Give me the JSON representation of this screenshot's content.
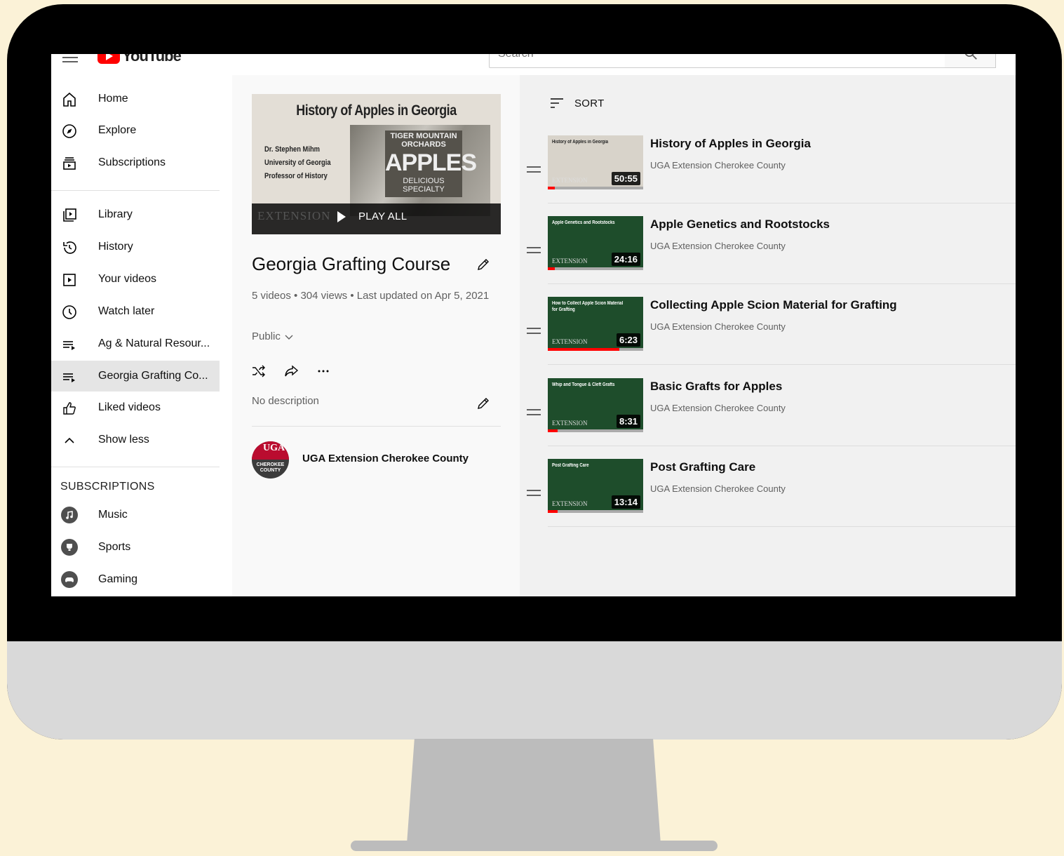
{
  "brand": {
    "name": "YouTube"
  },
  "search": {
    "placeholder": "Search"
  },
  "sidebar": {
    "items": [
      {
        "label": "Home",
        "icon": "home-icon"
      },
      {
        "label": "Explore",
        "icon": "compass-icon"
      },
      {
        "label": "Subscriptions",
        "icon": "subscriptions-icon"
      },
      {
        "label": "Library",
        "icon": "library-icon"
      },
      {
        "label": "History",
        "icon": "history-icon"
      },
      {
        "label": "Your videos",
        "icon": "your-videos-icon"
      },
      {
        "label": "Watch later",
        "icon": "clock-icon"
      },
      {
        "label": "Ag & Natural Resour...",
        "icon": "playlist-icon"
      },
      {
        "label": "Georgia Grafting Co...",
        "icon": "playlist-icon",
        "active": true
      },
      {
        "label": "Liked videos",
        "icon": "thumbs-up-icon"
      },
      {
        "label": "Show less",
        "icon": "chevron-up-icon"
      }
    ],
    "subscriptions_title": "SUBSCRIPTIONS",
    "subscriptions": [
      {
        "label": "Music",
        "icon": "music-icon"
      },
      {
        "label": "Sports",
        "icon": "trophy-icon"
      },
      {
        "label": "Gaming",
        "icon": "gaming-icon"
      }
    ]
  },
  "playlist": {
    "hero": {
      "title": "History of Apples in Georgia",
      "credits": [
        "Dr. Stephen Mihm",
        "University of Georgia",
        "Professor of History"
      ],
      "sign_top": "TIGER MOUNTAIN ORCHARDS",
      "sign_main": "APPLES",
      "sign_bottom": "DELICIOUS SPECIALTY",
      "extension": "EXTENSION"
    },
    "play_all_label": "PLAY ALL",
    "title": "Georgia Grafting Course",
    "meta": "5 videos • 304 views • Last updated on Apr 5, 2021",
    "privacy": "Public",
    "description": "No description",
    "owner": "UGA Extension Cherokee County",
    "owner_avatar_top": "UGA",
    "owner_avatar_bottom": "CHEROKEE COUNTY"
  },
  "list": {
    "sort_label": "SORT",
    "videos": [
      {
        "title": "History of Apples in Georgia",
        "channel": "UGA Extension Cherokee County",
        "duration": "50:55",
        "thumb_text": "History of Apples in Georgia",
        "thumb_bg": "#d8d3ca",
        "thumb_fg": "#222222",
        "progress": 0.07
      },
      {
        "title": "Apple Genetics and Rootstocks",
        "channel": "UGA Extension Cherokee County",
        "duration": "24:16",
        "thumb_text": "Apple Genetics and Rootstocks",
        "thumb_bg": "#1e4d2b",
        "thumb_fg": "#ffffff",
        "progress": 0.07
      },
      {
        "title": "Collecting Apple Scion Material for Grafting",
        "channel": "UGA Extension Cherokee County",
        "duration": "6:23",
        "thumb_text": "How to Collect Apple Scion Material for Grafting",
        "thumb_bg": "#1e4d2b",
        "thumb_fg": "#ffffff",
        "progress": 0.75
      },
      {
        "title": "Basic Grafts for Apples",
        "channel": "UGA Extension Cherokee County",
        "duration": "8:31",
        "thumb_text": "Whip and Tongue & Cleft Grafts",
        "thumb_bg": "#1e4d2b",
        "thumb_fg": "#ffffff",
        "progress": 0.1
      },
      {
        "title": "Post Grafting Care",
        "channel": "UGA Extension Cherokee County",
        "duration": "13:14",
        "thumb_text": "Post Grafting Care",
        "thumb_bg": "#1e4d2b",
        "thumb_fg": "#ffffff",
        "progress": 0.1
      }
    ]
  }
}
